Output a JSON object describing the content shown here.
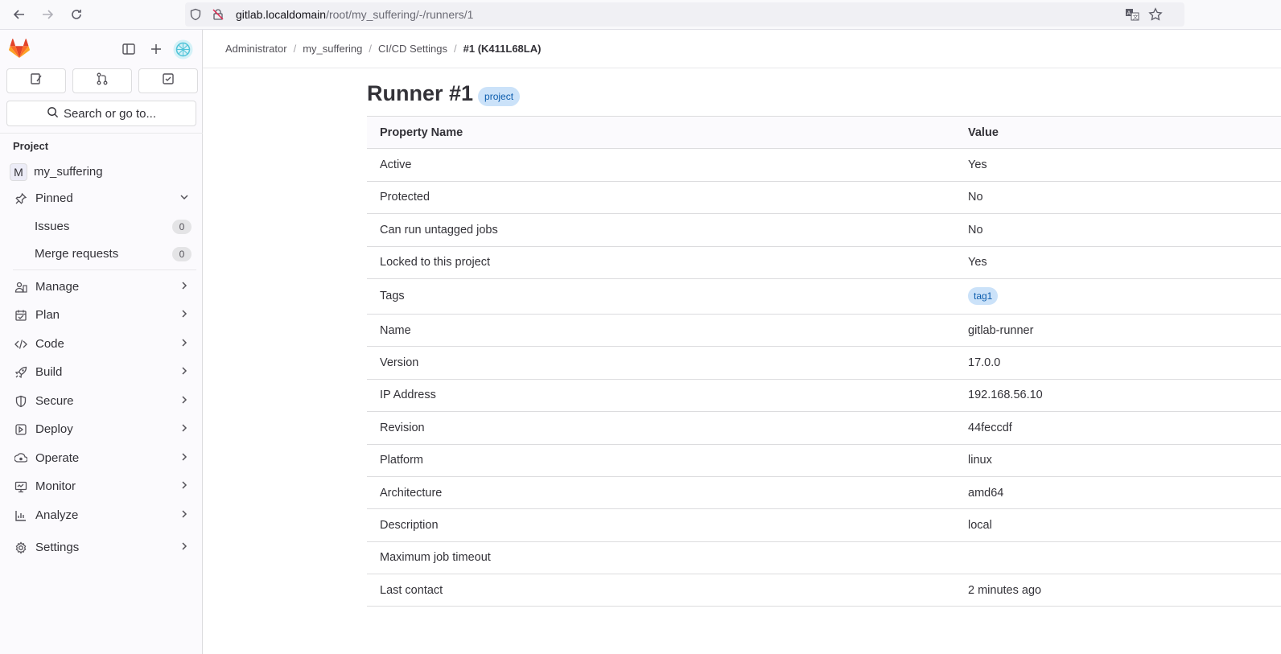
{
  "browser": {
    "url_host": "gitlab.localdomain",
    "url_path": "/root/my_suffering/-/runners/1"
  },
  "sidebar": {
    "search_label": "Search or go to...",
    "section_title": "Project",
    "project_initial": "M",
    "project_name": "my_suffering",
    "pinned_label": "Pinned",
    "pinned_items": [
      {
        "label": "Issues",
        "count": "0"
      },
      {
        "label": "Merge requests",
        "count": "0"
      }
    ],
    "nav_items": [
      {
        "label": "Manage",
        "icon": "manage-icon"
      },
      {
        "label": "Plan",
        "icon": "plan-icon"
      },
      {
        "label": "Code",
        "icon": "code-icon"
      },
      {
        "label": "Build",
        "icon": "build-icon"
      },
      {
        "label": "Secure",
        "icon": "shield-icon"
      },
      {
        "label": "Deploy",
        "icon": "deploy-icon"
      },
      {
        "label": "Operate",
        "icon": "operate-icon"
      },
      {
        "label": "Monitor",
        "icon": "monitor-icon"
      },
      {
        "label": "Analyze",
        "icon": "analyze-icon"
      }
    ],
    "settings_label": "Settings"
  },
  "breadcrumb": {
    "items": [
      "Administrator",
      "my_suffering",
      "CI/CD Settings"
    ],
    "current": "#1 (K411L68LA)"
  },
  "page": {
    "title": "Runner #1",
    "badge": "project"
  },
  "table": {
    "headers": [
      "Property Name",
      "Value"
    ],
    "rows": [
      {
        "name": "Active",
        "value": "Yes"
      },
      {
        "name": "Protected",
        "value": "No"
      },
      {
        "name": "Can run untagged jobs",
        "value": "No"
      },
      {
        "name": "Locked to this project",
        "value": "Yes"
      },
      {
        "name": "Tags",
        "value": "tag1"
      },
      {
        "name": "Name",
        "value": "gitlab-runner"
      },
      {
        "name": "Version",
        "value": "17.0.0"
      },
      {
        "name": "IP Address",
        "value": "192.168.56.10"
      },
      {
        "name": "Revision",
        "value": "44feccdf"
      },
      {
        "name": "Platform",
        "value": "linux"
      },
      {
        "name": "Architecture",
        "value": "amd64"
      },
      {
        "name": "Description",
        "value": "local"
      },
      {
        "name": "Maximum job timeout",
        "value": ""
      },
      {
        "name": "Last contact",
        "value": "2 minutes ago"
      }
    ]
  },
  "colors": {
    "badge_bg": "#cbe2f9",
    "badge_text": "#0b5cad",
    "tanuki_orange": "#fc6d26",
    "tanuki_red": "#e24329"
  }
}
